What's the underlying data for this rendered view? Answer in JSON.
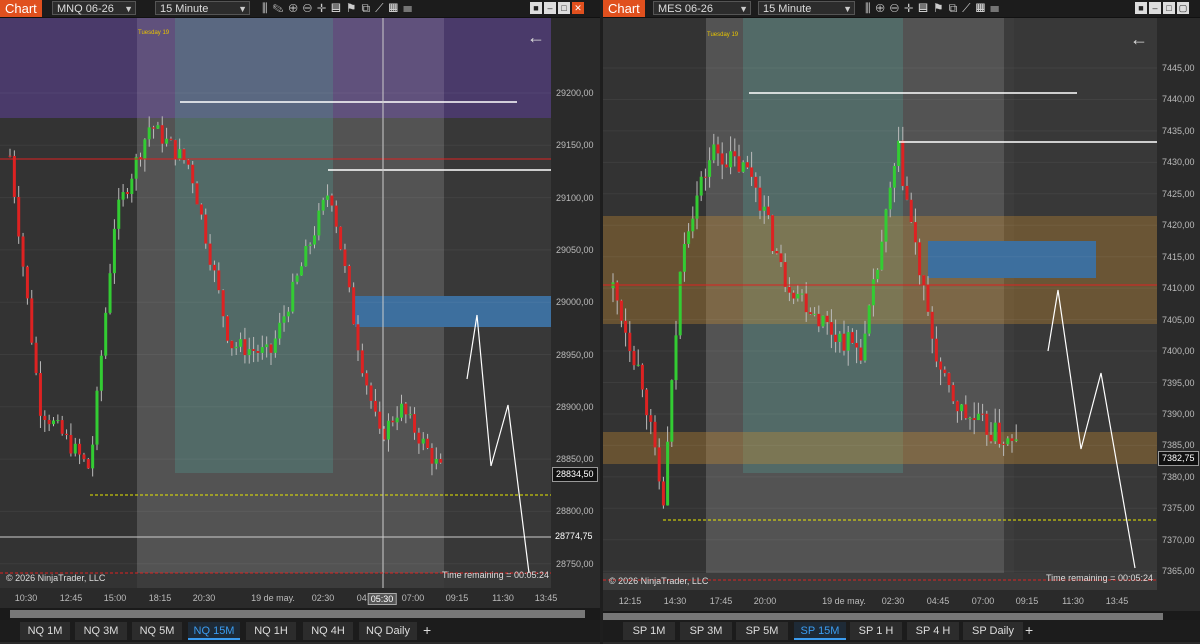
{
  "left": {
    "chart_label": "Chart",
    "instrument": "MNQ 06-26",
    "interval": "15 Minute",
    "copyright": "© 2026 NinjaTrader, LLC",
    "time_remaining": "Time remaining = 00:05:24",
    "day_label": "Tuesday 19",
    "f_label": "F",
    "price_labels": [
      "29200,00",
      "29150,00",
      "29100,00",
      "29050,00",
      "29000,00",
      "28950,00",
      "28900,00",
      "28850,00",
      "28800,00",
      "28750,00"
    ],
    "current_price": "28834,50",
    "crosshair_price": "28774,75",
    "time_labels": [
      "10:30",
      "12:45",
      "15:00",
      "18:15",
      "20:30",
      "19 de may.",
      "02:30",
      "04:",
      "05:30",
      "07:00",
      "09:15",
      "11:30",
      "13:45"
    ],
    "tabs": [
      "NQ 1M",
      "NQ 3M",
      "NQ 5M",
      "NQ 15M",
      "NQ 1H",
      "NQ 4H",
      "NQ Daily"
    ],
    "active_tab": "NQ 15M",
    "seed": 7,
    "price_top": 29230,
    "price_bottom": 28740
  },
  "right": {
    "chart_label": "Chart",
    "instrument": "MES 06-26",
    "interval": "15 Minute",
    "copyright": "© 2026 NinjaTrader, LLC",
    "time_remaining": "Time remaining = 00:05:24",
    "day_label": "Tuesday 19",
    "f_label": "F",
    "price_labels": [
      "7445,00",
      "7440,00",
      "7435,00",
      "7430,00",
      "7425,00",
      "7420,00",
      "7415,00",
      "7410,00",
      "7405,00",
      "7400,00",
      "7395,00",
      "7390,00",
      "7385,00",
      "7380,00",
      "7375,00",
      "7370,00",
      "7365,00"
    ],
    "current_price": "7382,75",
    "time_labels": [
      "12:15",
      "14:30",
      "17:45",
      "20:00",
      "19 de may.",
      "02:30",
      "04:45",
      "07:00",
      "09:15",
      "11:30",
      "13:45"
    ],
    "tabs": [
      "SP 1M",
      "SP 3M",
      "SP 5M",
      "SP 15M",
      "SP 1 H",
      "SP 4 H",
      "SP Daily"
    ],
    "active_tab": "SP 15M",
    "seed": 13,
    "price_top": 7449,
    "price_bottom": 7362
  },
  "colors": {
    "bull": "#33cc33",
    "bear": "#dd2222",
    "accent": "#e0501e",
    "tab_active": "#3b9cf0"
  },
  "tabs_plus": "+"
}
